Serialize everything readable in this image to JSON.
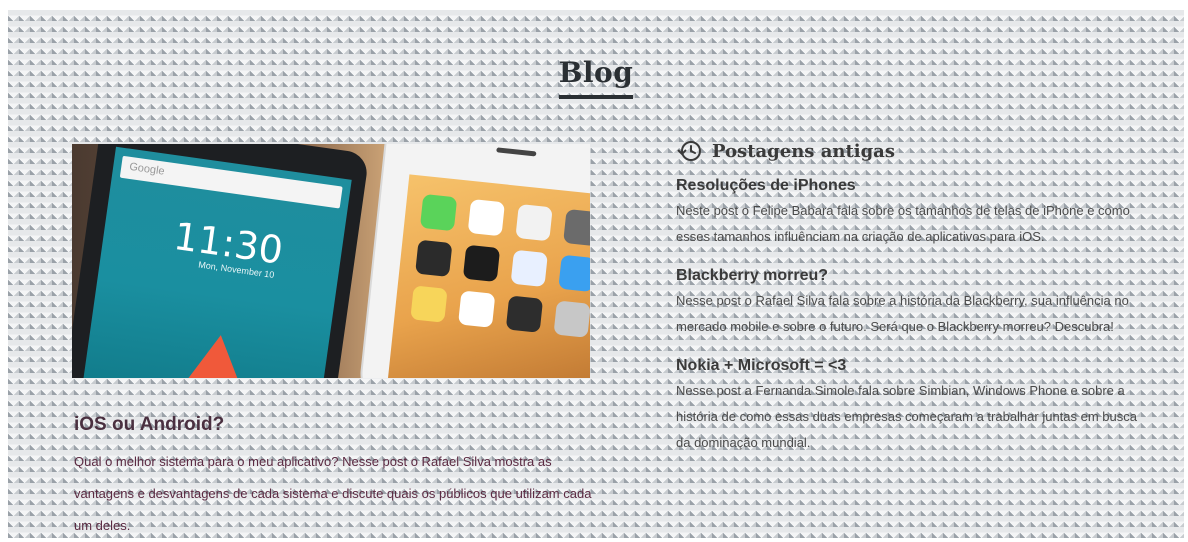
{
  "blog": {
    "title": "Blog"
  },
  "featured_post": {
    "title": "iOS ou Android?",
    "excerpt": "Qual o melhor sistema para o meu aplicativo? Nesse post o Rafael Silva mostra as vantagens e desvantagens de cada sistema e discute quais os públicos que utilizam cada um deles.",
    "image": {
      "search_label": "Google",
      "clock_time": "11:30",
      "clock_date": "Mon, November 10"
    }
  },
  "sidebar": {
    "heading": "Postagens antigas",
    "icon": "history-icon",
    "posts": [
      {
        "title": "Resoluções de iPhones",
        "excerpt": "Neste post o Felipe Babara fala sobre os tamanhos de telas de iPhone e como esses tamanhos influênciam na criação de aplicativos para iOS."
      },
      {
        "title": "Blackberry morreu?",
        "excerpt": "Nesse post o Rafael Silva fala sobre a história da Blackberry, sua influência no mercado mobile e sobre o futuro. Será que o Blackberry morreu? Descubra!"
      },
      {
        "title": "Nokia + Microsoft = <3",
        "excerpt": "Nesse post a Fernanda Simole fala sobre Simbian, Windows Phone e sobre a história de como essas duas empresas começaram a trabalhar juntas em busca da dominação mundial."
      }
    ]
  },
  "colors": {
    "pattern_dark": "#9aa1a8",
    "pattern_light": "#e6e8ea",
    "heading": "#2a2f33",
    "featured_text": "#5b2a42"
  }
}
